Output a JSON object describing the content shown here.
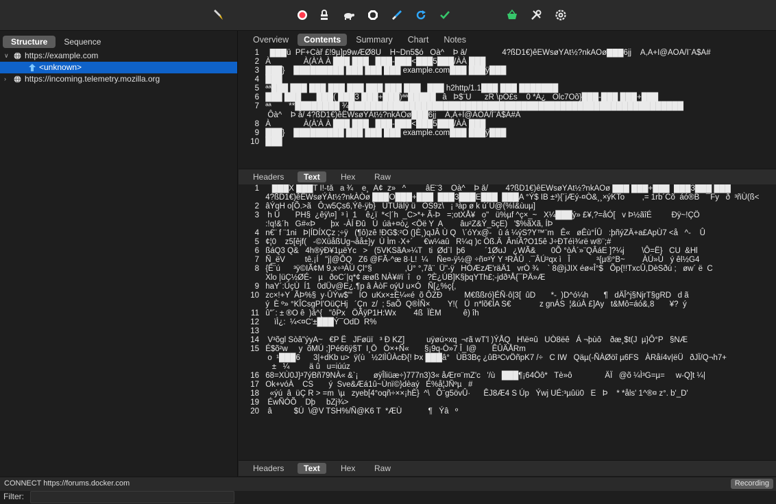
{
  "toolbar": {
    "icons": [
      "pen-icon",
      "record-icon",
      "lock-icon",
      "turtle-icon",
      "stop-icon",
      "brush-icon",
      "reload-icon",
      "check-icon",
      "basket-icon",
      "tools-icon",
      "gear-icon"
    ],
    "record_color": "#ff3b4e",
    "pen_color": "#f0c020",
    "reload_color": "#2fa8ff",
    "check_color": "#37c76b",
    "basket_color": "#37c76b"
  },
  "left": {
    "tabs": [
      "Structure",
      "Sequence"
    ],
    "tree": {
      "host1": "https://example.com",
      "child": "<unknown>",
      "host2": "https://incoming.telemetry.mozilla.org"
    },
    "filter_label": "Filter:"
  },
  "right": {
    "top_tabs": [
      "Overview",
      "Contents",
      "Summary",
      "Chart",
      "Notes"
    ],
    "request_lines": [
      {
        "n": "1",
        "t": "   ███ü  PF+Càř £!9µ]p9wÆØ8Ü    H~Dn5$ó   Ôà^    Þ å/                4?ßD1€)êËWsøÝÀt½?nkÀÒø███6jj    À,À+Ì@ÀÒÀ/Ì¨À$À#"
      },
      {
        "n": "2",
        "t": " À               À(À'À À ███ ███   ███-███<███5███/ÀÀ ███"
      },
      {
        "n": "3",
        "t": " ███}    █████████ ███ ███ ███ example.com███ ███ÿ███"
      },
      {
        "n": "4",
        "t": " ███"
      },
      {
        "n": "5",
        "t": " ªª███ ███ ███ ███ ███ ███ ███ ███   ███ h2http/1.1███ ███ ███████"
      },
      {
        "n": "6",
        "t": " ███ ███       ███( ███3 ███+███)ªª█████   â   Þ$¨U      zR \\pÓ£s    0 *À¿   Olc7Oõ}███-███ ███+███"
      },
      {
        "n": "7",
        "t": " ªª        **████████ ¾████████████████████████████████████████████████████████████"
      },
      {
        "n": "",
        "t": "  Ôà^    Þ å/ 4?ßD1€)êËWsøÝÀt½?nkÀÒø███6jj    À,À+Ì@ÀÒÀ/Ì¨À$À#À"
      },
      {
        "n": "8",
        "t": " À               À(À'À À ███ ███   ███-███<███5███/ÀÀ ███"
      },
      {
        "n": "9",
        "t": " ███}    █████████ ███ ███ ███ example.com███ ███ÿ███"
      },
      {
        "n": "10",
        "t": " ███"
      }
    ],
    "mid_subtabs": [
      "Headers",
      "Text",
      "Hex",
      "Raw"
    ],
    "response_lines": [
      {
        "n": "1",
        "t": "    ███X ███T Ï!-tå   a ¾    e¸  Â¢  z»   ^         âÈ¨3    Ôà^    Þ å/        4?ßD1€)êËWsøÝÀt½?nkÀÒø ███ ███+███  ███3███ ███"
      },
      {
        "n": "",
        "t": " 4?ßD1€)êËWsøÝÀt½?nkÀÒø ███O███+███  ███3███E███  ███A °Ý$ IB ±³){´jÆý-¤Ò&¸¸×ýKTo        ,= 1rb´Cõ  áó®B   ¯Fy   ð  ³ñÙ(ß<"
      },
      {
        "n": "2",
        "t": " âÝqH o[Õ.>ã   Ô;w5Çs6,Ýê-ÿb}   ÙTÚäÌÿ ü   ÒS9z\\   ¡ ³àp ø k ú´Ù@(%Ì&ùuµ]"
      },
      {
        "n": "3",
        "t": "  h Û       PH§  ¿êÿ\\¤]  ³ ì  1    ê¿ï  *<|´h  _C>*+ Ã-Þ   =;otXÅ¥   o\"   ü%µf ^ç×_~   X¼███ý» £¥,?=åÓ[   v Þ½ãîÉ         Ðÿ~!ÇÖ"
      },
      {
        "n": "",
        "t": " :!q!&´h   G#«Þ       þx  -ÀÍ Ðû   Ú  úä+¤ò¿ <Öë Y  A        âu²Z&Ý_5çE)   '$%ãXã, ÍÞ"
      },
      {
        "n": "4",
        "t": " n€¨ f ¨1ni   Þ|ÍDÍXÇz ;÷ÿ   (¶ô)zê !ÐG$:²O (}È¸)qJÂ Ù Q   \\´óYx@-   û á ¼ýS?Y™¨m   Ê«   øÊù°ÍÛ   :þñýZÄ+a£ApÙ7 <å   ^-    Û"
      },
      {
        "n": "5",
        "t": " ¢¦0    z5[êjf(   -©XüåßUg¬åå±}y  Ù Ìm ·X+´     €w¼aû   R¼q )c Öß.Ä  ÂníÂ?O15ê J÷ÐTéì¾rë w®¨;#"
      },
      {
        "n": "6",
        "t": " ßáQ3 Q&   4h®ÿÐ¥1µëYc   >   (5VKSãA»¼T   ti  Ød`l  þ6         ´1ØuJ   ¿WÃ&       0Õ °òÀ´»¨QÂáE ]?¼j        \\Ô=Ë}   CU  &Hl"
      },
      {
        "n": "7",
        "t": " Ñ_ëV         tê.¡Í   \"j|@ÕQ   Z6 @FÃ-^æ 8·L!  ¼    Ñe¤-ÿ½@ ÷ñ¤³Ý Y ³RÀÛ  .¯ÂÚ²qx ì   Î            ³{µ®°B~        ÀÚ»Ù   ý êl½G4"
      },
      {
        "n": "8",
        "t": " {Ê¨ú      ³ÿ©IÃ¢M 9,x÷³ÀÚ Çl°§               ,Ú° °,7â¨  Ü\"-ÿ   HÓÆzÆ'räÄ1   vrÒ ¾    ` 8@jJIX éø«Î°$   Õp{!!TxcÛ,DèSðú ;   øw´ ë  C"
      },
      {
        "n": "",
        "t": " Xlo |üÇ½ØÉ-   µ   ðoC´|q*¢ æøß NÀ¥#ï  î   o   ?È¿ÚB]K§þqYTh£;-jdð³Å{¯PÄ»Æ"
      },
      {
        "n": "9",
        "t": " haY´:ÚçÙ  Í1   0dÜv@E¿.¶p â ÀòF oýU u×Ó   Ñ[¿%ç{,"
      },
      {
        "n": "10",
        "t": " zc×!+Y  ÃÞ%§  y·ÛÝw$\"'   ÍO  uKx×±È¼«é  õ ÔZÐ          M€ßßró}ÉÑ·ô|3[  ûD       *-  )D^ó¼h       ¶   dÄÎ^j§NjrT§gRD   d ã"
      },
      {
        "n": "",
        "t": " ý  È º» °KÎCsgPI'OüÇHj   ´Çn  z/  ; 5aÕ  Q®ÌÑ×        Y!(   Ü  n*lõ€ÍA S€             z gnÁS  ¦&úÀ £]Ay   t&Mô=áó&,8       ¥?  ý"
      },
      {
        "n": "11",
        "t": " û\"´: ± ®O ê  )å^{   \"ôPx   ÖÃÿP1H:Wx        4ß  ÏÈM          ê) îh"
      },
      {
        "n": "12",
        "t": "     ïÌ¿:  ¼<¤C'±███Ý¯OdD  R%"
      },
      {
        "n": "13",
        "t": ""
      },
      {
        "n": "14",
        "t": "  V³õgl Sòâ\"ýyA~   €P Ë   JFøüï   ³ Ð KZ]          uÿøú×xq  ¬rã wT'l )ÝÅQ   H\\ë¤û   UÒ8ëê   Á ¬þùô    ðæ¸$t(J  µ}Ô°P   §NÆ"
      },
      {
        "n": "15",
        "t": " É$õ²w     y  õMÚ ;]Pé66ÿ§T  I¸Ö   Ò×+Ñ«       §¡9q-Ò»7 Î_I@       ÊÛÄÅRm"
      },
      {
        "n": "",
        "t": "  o  ¹███6      3|+dKb u>  ÿ(ù   ½2lÌÛÀcÐ{! Þx ███â°   ÙB3Bç ¿ûB³CvÖñpK7 /÷   C IW   Qäµ(-ÑÀØöî µ6FS   ÀRåí4v|ëÜ   ðJÏ/Q¬h7+"
      },
      {
        "n": "",
        "t": "    ±   ¼         ä û   u=iúúz"
      },
      {
        "n": "16",
        "t": " 68=XÙ0J}³7ýBñ79NÀ« &`¡       øÿÎliüæ÷)777n3)3« åÆr¤¨mZ'c   '/ù   ███¶¡64Öô*   Tè»ô               ÄÏ   @õ ¼Ì³G=µ=     w-Q]t ¼|"
      },
      {
        "n": "17",
        "t": " Ok+vóÀ    CS       ý  Sve&Æá1û~Ùnï©}dèaý   É%å¦JÑºµ   #"
      },
      {
        "n": "18",
        "t": "   «ýú  â  üÇ R > =m  \\µ   zyeb[4°oqñ÷××¡hÈ}  ^\\   Õ¨g5övÛ·      ÊJ8Æ4 S Úp   Ýwj UÉ:³µûü0   E   Þ    * *åls' 1^®¤ z°. b'_D'"
      },
      {
        "n": "19",
        "t": "  ÉwÑÓÕ    Dþ     bZj¾>"
      },
      {
        "n": "20",
        "t": "  â          $Ú  \\@V TSH%/Ñ@K6 T  *ÆÙ            ¶   Ýâ   º"
      }
    ],
    "bottom_subtabs": [
      "Headers",
      "Text",
      "Hex",
      "Raw"
    ]
  },
  "status": {
    "text": "CONNECT https://forums.docker.com",
    "recording": "Recording"
  }
}
